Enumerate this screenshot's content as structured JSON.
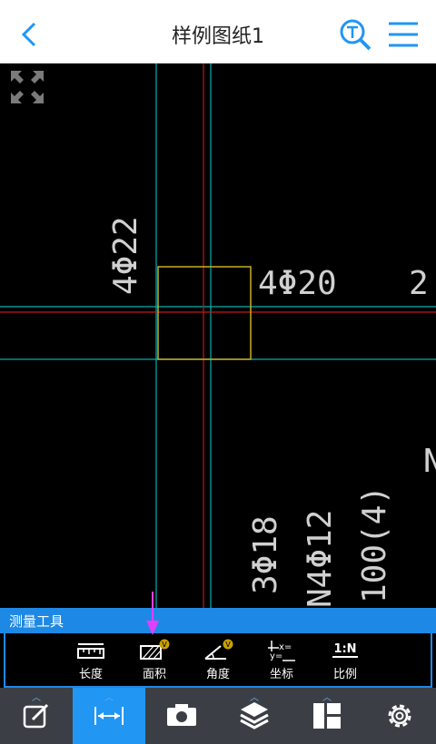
{
  "header": {
    "title": "样例图纸1"
  },
  "canvas": {
    "labels": [
      "4Φ22",
      "4Φ20",
      "2",
      "N",
      "3Φ18",
      "N4Φ12",
      "100(4)"
    ]
  },
  "tools": {
    "title": "测量工具",
    "items": [
      {
        "label": "长度",
        "icon": "ruler-icon"
      },
      {
        "label": "面积",
        "icon": "area-icon",
        "badge": "V"
      },
      {
        "label": "角度",
        "icon": "angle-icon",
        "badge": "V"
      },
      {
        "label": "坐标",
        "icon": "coordinate-icon"
      },
      {
        "label": "比例",
        "icon": "scale-icon",
        "top": "1:N"
      }
    ]
  },
  "bottombar": {
    "tabs": [
      {
        "name": "edit-icon",
        "active": false
      },
      {
        "name": "measure-icon",
        "active": true
      },
      {
        "name": "camera-icon",
        "active": false
      },
      {
        "name": "layers-icon",
        "active": false
      },
      {
        "name": "layout-icon",
        "active": false
      },
      {
        "name": "settings-icon",
        "active": false
      }
    ]
  },
  "colors": {
    "accent": "#2196f3",
    "cyan": "#00c8c8",
    "red": "#d02020",
    "yellow": "#c8b020",
    "arrow": "#e040fb"
  }
}
